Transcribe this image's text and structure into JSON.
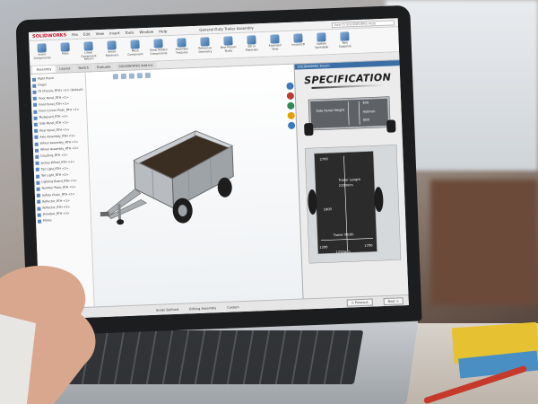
{
  "app": {
    "logo": "SOLIDWORKS",
    "menu": [
      "File",
      "Edit",
      "View",
      "Insert",
      "Tools",
      "Window",
      "Help"
    ],
    "document_title": "General Duty Trailer Assembly",
    "search_placeholder": "Search SOLIDWORKS Help"
  },
  "ribbon": {
    "buttons": [
      "Insert Components",
      "Mate",
      "Linear Component Pattern",
      "Smart Fasteners",
      "Move Component",
      "Show Hidden Components",
      "Assembly Features",
      "Reference Geometry",
      "New Motion Study",
      "Bill of Materials",
      "Exploded View",
      "Instant3D",
      "Update Speedpak",
      "Take Snapshot"
    ]
  },
  "tabs": [
    "Assembly",
    "Layout",
    "Sketch",
    "Evaluate",
    "SOLIDWORKS Add-Ins"
  ],
  "tree": {
    "items": [
      "Right Plane",
      "Origin",
      "(f) Chassis_RTH1 <1> (Default)",
      "Floor Panel_RTH <1>",
      "Front Panel_RTH <1>",
      "Front Corner Plate_RTH <1>",
      "Mudguard_RTH <1>",
      "Side Panel_RTH <1>",
      "Rear Panel_RTH <1>",
      "Axle Assembly_RTH <1>",
      "Wheel Assembly_RTH <1>",
      "Wheel Assembly_RTH <2>",
      "Coupling_RTH <1>",
      "Jockey Wheel_RTH <1>",
      "Tail Light_RTH <1>",
      "Tail Light_RTH <2>",
      "Lighting Board_RTH <1>",
      "Number Plate_RTH <1>",
      "Safety Chain_RTH <1>",
      "Reflector_RTH <1>",
      "Reflector_RTH <2>",
      "Drawbar_RTH <1>",
      "Mates"
    ]
  },
  "taskpane": {
    "header": "SOLIDWORKS Forum",
    "title": "SPECIFICATION",
    "side_panel_label": "Side Panel Height",
    "side_dim_1": "300",
    "side_dim_2": "450mm",
    "side_dim_3": "600",
    "trailer_length_label": "Trailer Length",
    "trailer_length_value": "2100mm",
    "length_top": "2700",
    "length_mid": "1800",
    "trailer_width_label": "Trailer Width",
    "width_left": "1200",
    "width_value": "1250mm",
    "width_right": "1700"
  },
  "statusbar": {
    "cancel": "Cancel",
    "under_defined": "Under Defined",
    "editing": "Editing Assembly",
    "custom": "Custom",
    "previous": "< Previous",
    "next": "Next >"
  }
}
